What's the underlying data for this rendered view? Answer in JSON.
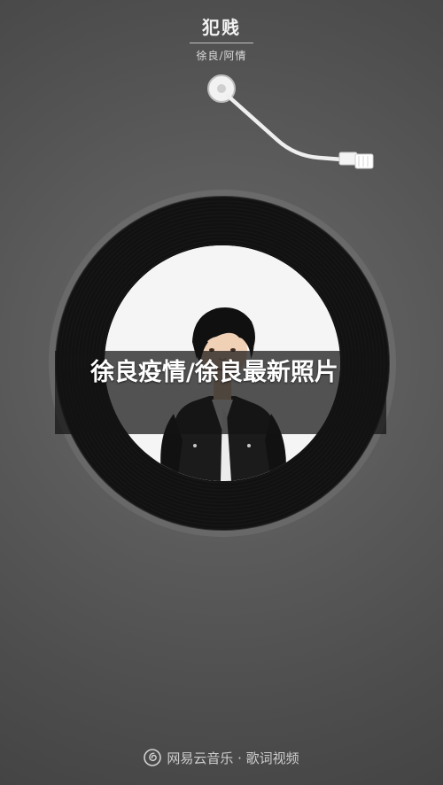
{
  "song": {
    "title": "犯贱",
    "artist_line": "徐良/阿情"
  },
  "cover": {
    "description_icon": "album-cover-photo"
  },
  "overlay": {
    "headline": "徐良疫情/徐良最新照片"
  },
  "footer": {
    "brand_icon": "netease-cloud-music-logo",
    "text": "网易云音乐 · 歌词视频"
  },
  "colors": {
    "background": "#5b5b5b",
    "record": "#111111",
    "text": "#ffffff"
  }
}
